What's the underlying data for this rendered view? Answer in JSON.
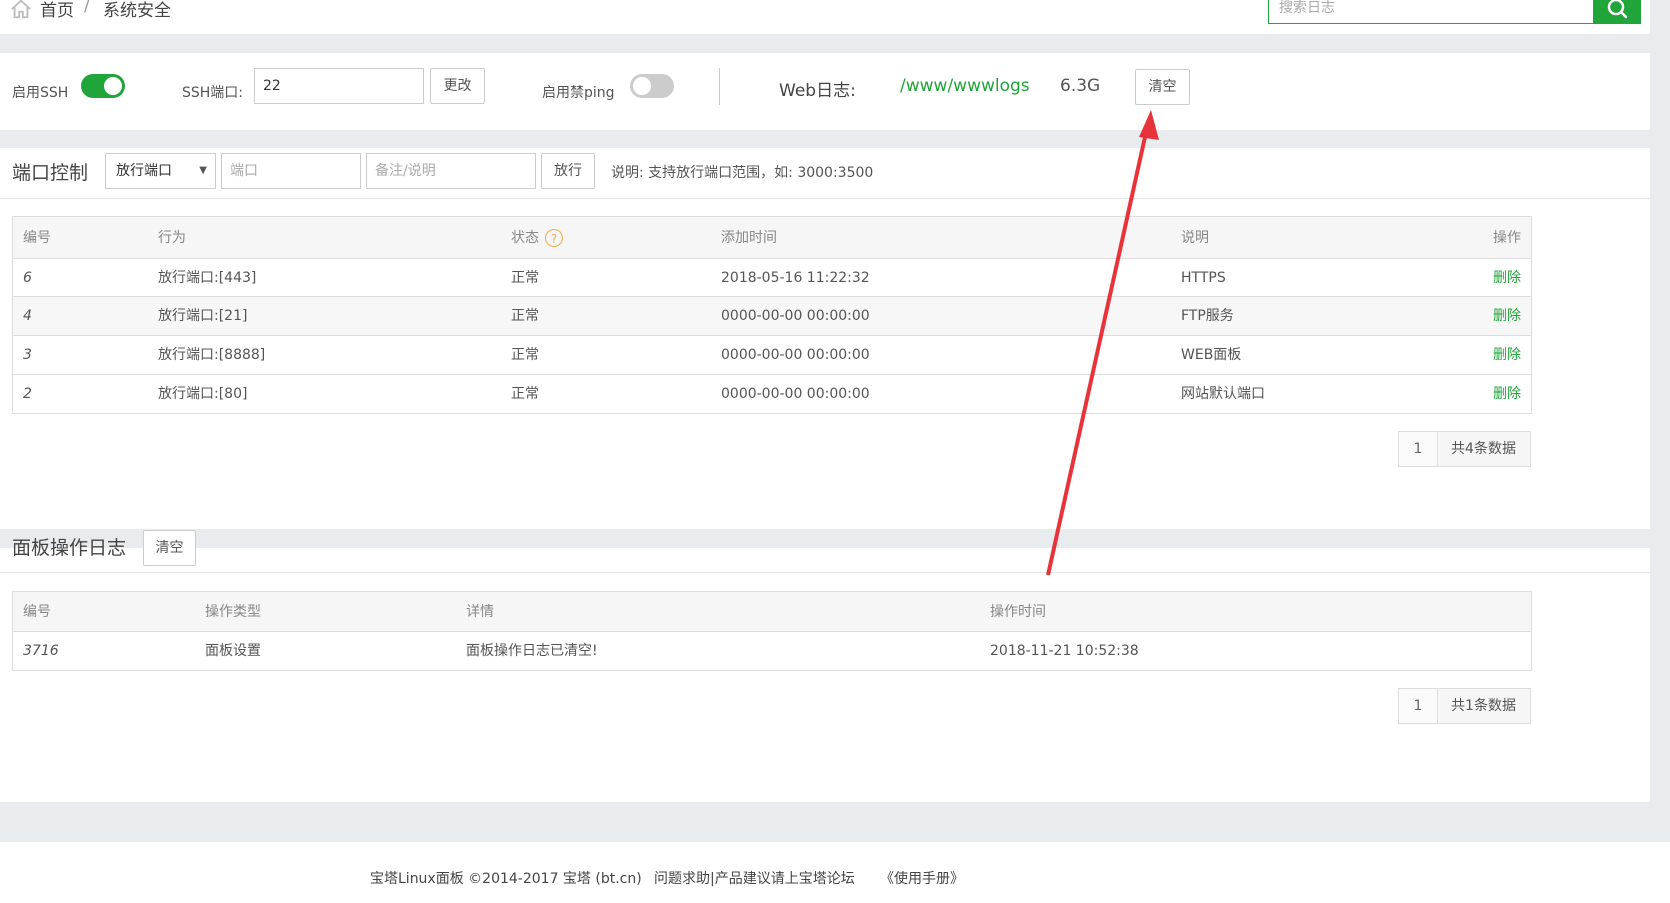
{
  "breadcrumb": {
    "home": "首页",
    "separator": "/",
    "current": "系统安全"
  },
  "search": {
    "placeholder": "搜索日志",
    "icon": "search-icon"
  },
  "ssh": {
    "enable_label": "启用SSH",
    "enabled": true,
    "port_label": "SSH端口:",
    "port_value": "22",
    "change_button": "更改",
    "ping_label": "启用禁ping",
    "ping_enabled": false,
    "web_log_label": "Web日志:",
    "web_log_path": "/www/wwwlogs",
    "web_log_size": "6.3G",
    "clear_button": "清空"
  },
  "port_control": {
    "title": "端口控制",
    "select_value": "放行端口",
    "port_placeholder": "端口",
    "note_placeholder": "备注/说明",
    "allow_button": "放行",
    "hint": "说明: 支持放行端口范围，如: 3000:3500",
    "columns": [
      "编号",
      "行为",
      "状态",
      "添加时间",
      "说明",
      "操作"
    ],
    "rows": [
      {
        "id": "6",
        "action": "放行端口:[443]",
        "status": "正常",
        "time": "2018-05-16 11:22:32",
        "note": "HTTPS",
        "op": "删除"
      },
      {
        "id": "4",
        "action": "放行端口:[21]",
        "status": "正常",
        "time": "0000-00-00 00:00:00",
        "note": "FTP服务",
        "op": "删除"
      },
      {
        "id": "3",
        "action": "放行端口:[8888]",
        "status": "正常",
        "time": "0000-00-00 00:00:00",
        "note": "WEB面板",
        "op": "删除"
      },
      {
        "id": "2",
        "action": "放行端口:[80]",
        "status": "正常",
        "time": "0000-00-00 00:00:00",
        "note": "网站默认端口",
        "op": "删除"
      }
    ],
    "pager": {
      "page": "1",
      "total": "共4条数据"
    }
  },
  "panel_log": {
    "title": "面板操作日志",
    "clear_button": "清空",
    "columns": [
      "编号",
      "操作类型",
      "详情",
      "操作时间"
    ],
    "rows": [
      {
        "id": "3716",
        "type": "面板设置",
        "detail": "面板操作日志已清空!",
        "time": "2018-11-21 10:52:38"
      }
    ],
    "pager": {
      "page": "1",
      "total": "共1条数据"
    }
  },
  "footer": {
    "copyright": "宝塔Linux面板 ©2014-2017 宝塔 (bt.cn)",
    "forum_link": "问题求助|产品建议请上宝塔论坛",
    "manual_link": "《使用手册》"
  },
  "colors": {
    "accent": "#20a53a",
    "arrow": "#e8333a",
    "help": "#f0ad4e"
  }
}
